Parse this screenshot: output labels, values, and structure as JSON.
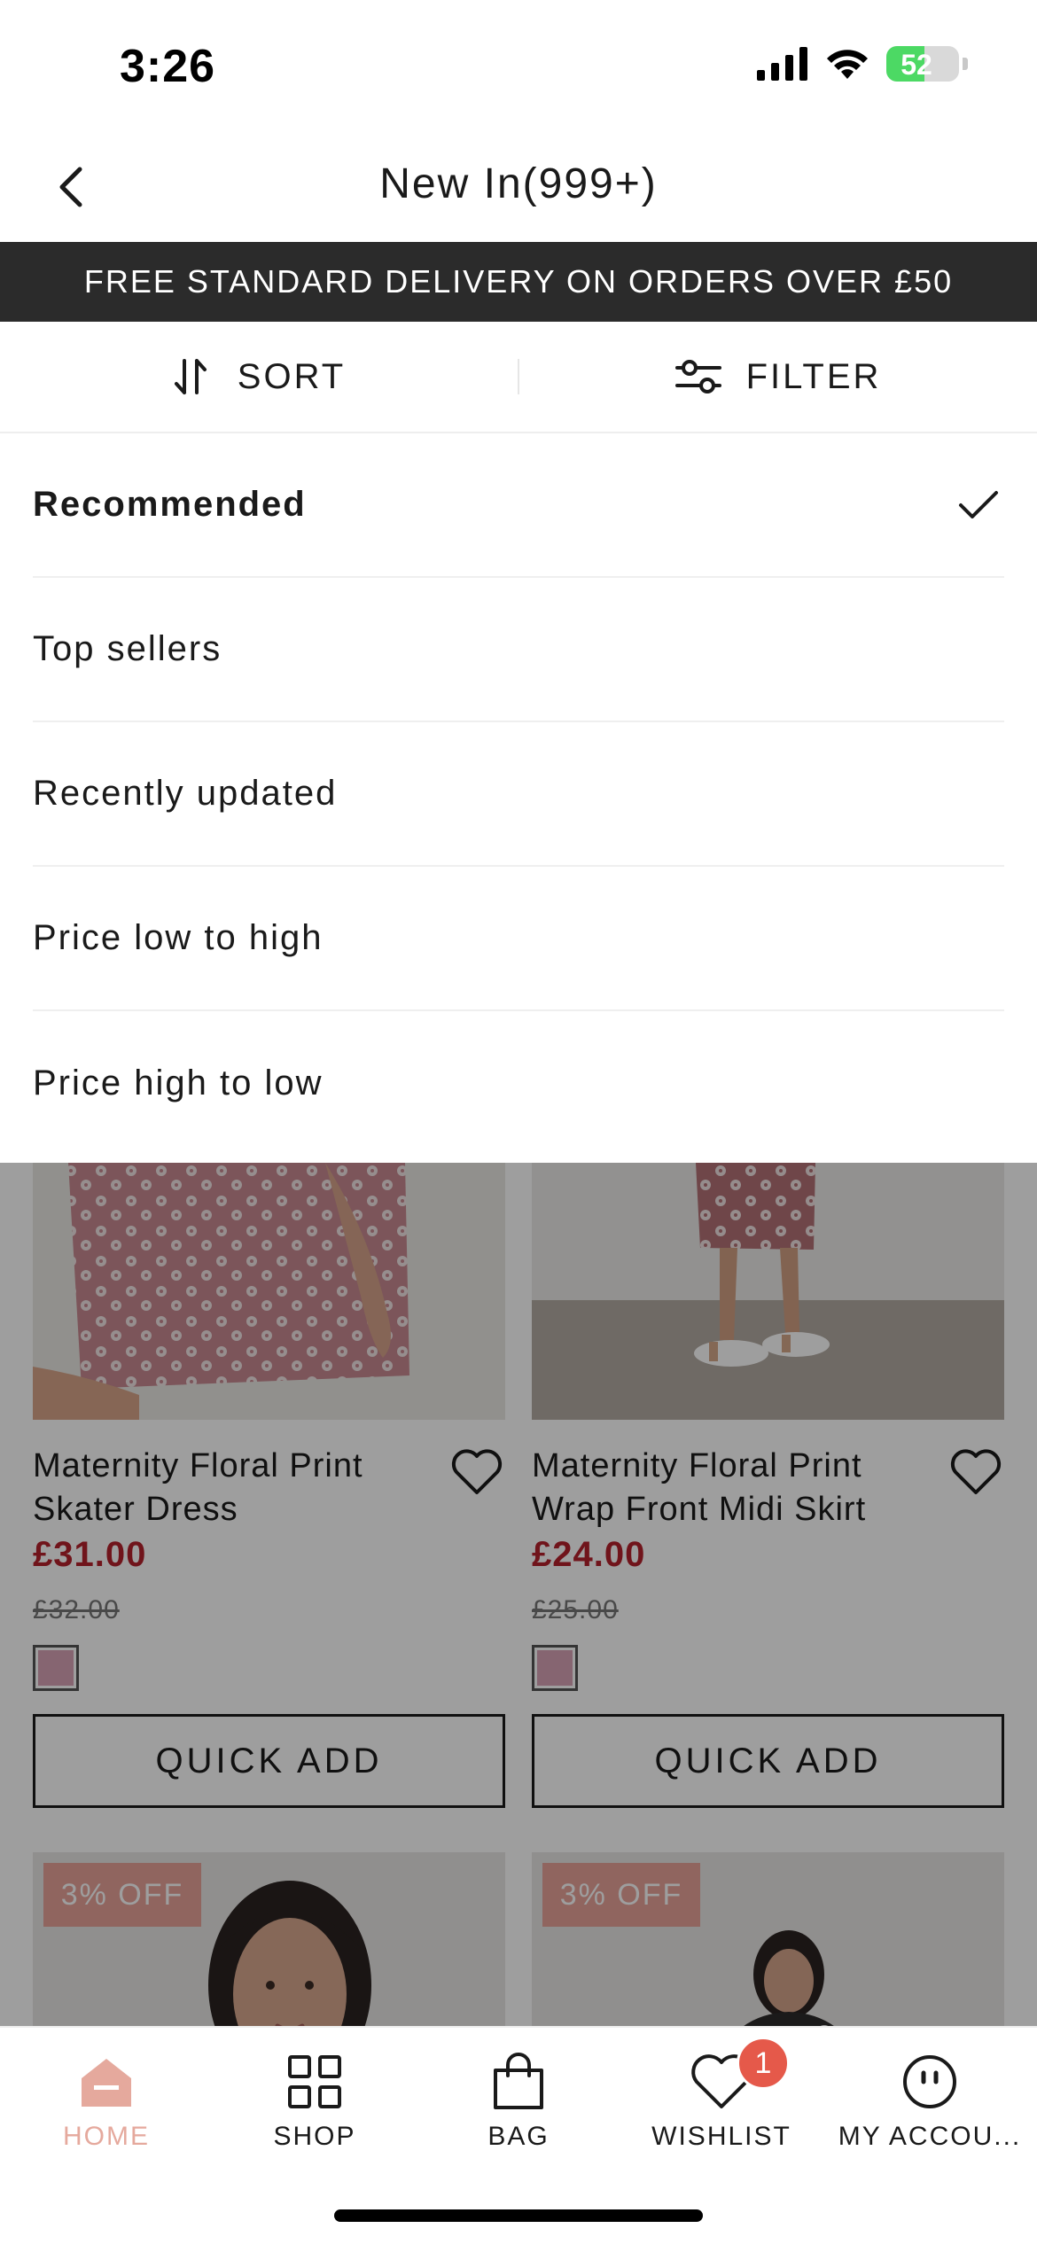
{
  "status_bar": {
    "time": "3:26",
    "battery_level": "52",
    "icons": [
      "cellular-signal-icon",
      "wifi-icon",
      "battery-charging-icon"
    ]
  },
  "header": {
    "title": "New In(999+)",
    "back_icon": "chevron-left-icon"
  },
  "promo_banner": {
    "text": "FREE STANDARD DELIVERY ON ORDERS OVER £50"
  },
  "toolbar": {
    "sort_label": "SORT",
    "sort_icon": "sort-arrows-icon",
    "filter_label": "FILTER",
    "filter_icon": "sliders-icon"
  },
  "sort_menu": {
    "selected": "Recommended",
    "options": [
      {
        "label": "Recommended"
      },
      {
        "label": "Top sellers"
      },
      {
        "label": "Recently updated"
      },
      {
        "label": "Price low to high"
      },
      {
        "label": "Price high to low"
      }
    ]
  },
  "products": [
    {
      "name": "Maternity Floral Print Skater Dress",
      "price": "£31.00",
      "was_price": "£32.00",
      "swatch_color": "#d8a4b6",
      "quick_add": "QUICK ADD"
    },
    {
      "name": "Maternity Floral Print Wrap Front Midi Skirt",
      "price": "£24.00",
      "was_price": "£25.00",
      "swatch_color": "#d8a4b6",
      "quick_add": "QUICK ADD"
    }
  ],
  "next_row_badges": [
    {
      "label": "3% OFF"
    },
    {
      "label": "3% OFF"
    }
  ],
  "tab_bar": {
    "active": "HOME",
    "tabs": [
      {
        "label": "HOME",
        "icon": "home-icon"
      },
      {
        "label": "SHOP",
        "icon": "grid-icon"
      },
      {
        "label": "BAG",
        "icon": "shopping-bag-icon"
      },
      {
        "label": "WISHLIST",
        "icon": "heart-icon",
        "badge": "1"
      },
      {
        "label": "MY ACCOU...",
        "icon": "account-icon"
      }
    ]
  },
  "colors": {
    "accent": "#e5a99d",
    "price_red": "#b5212c",
    "banner_bg": "#2b2b2b",
    "badge_red": "#e5594a"
  }
}
